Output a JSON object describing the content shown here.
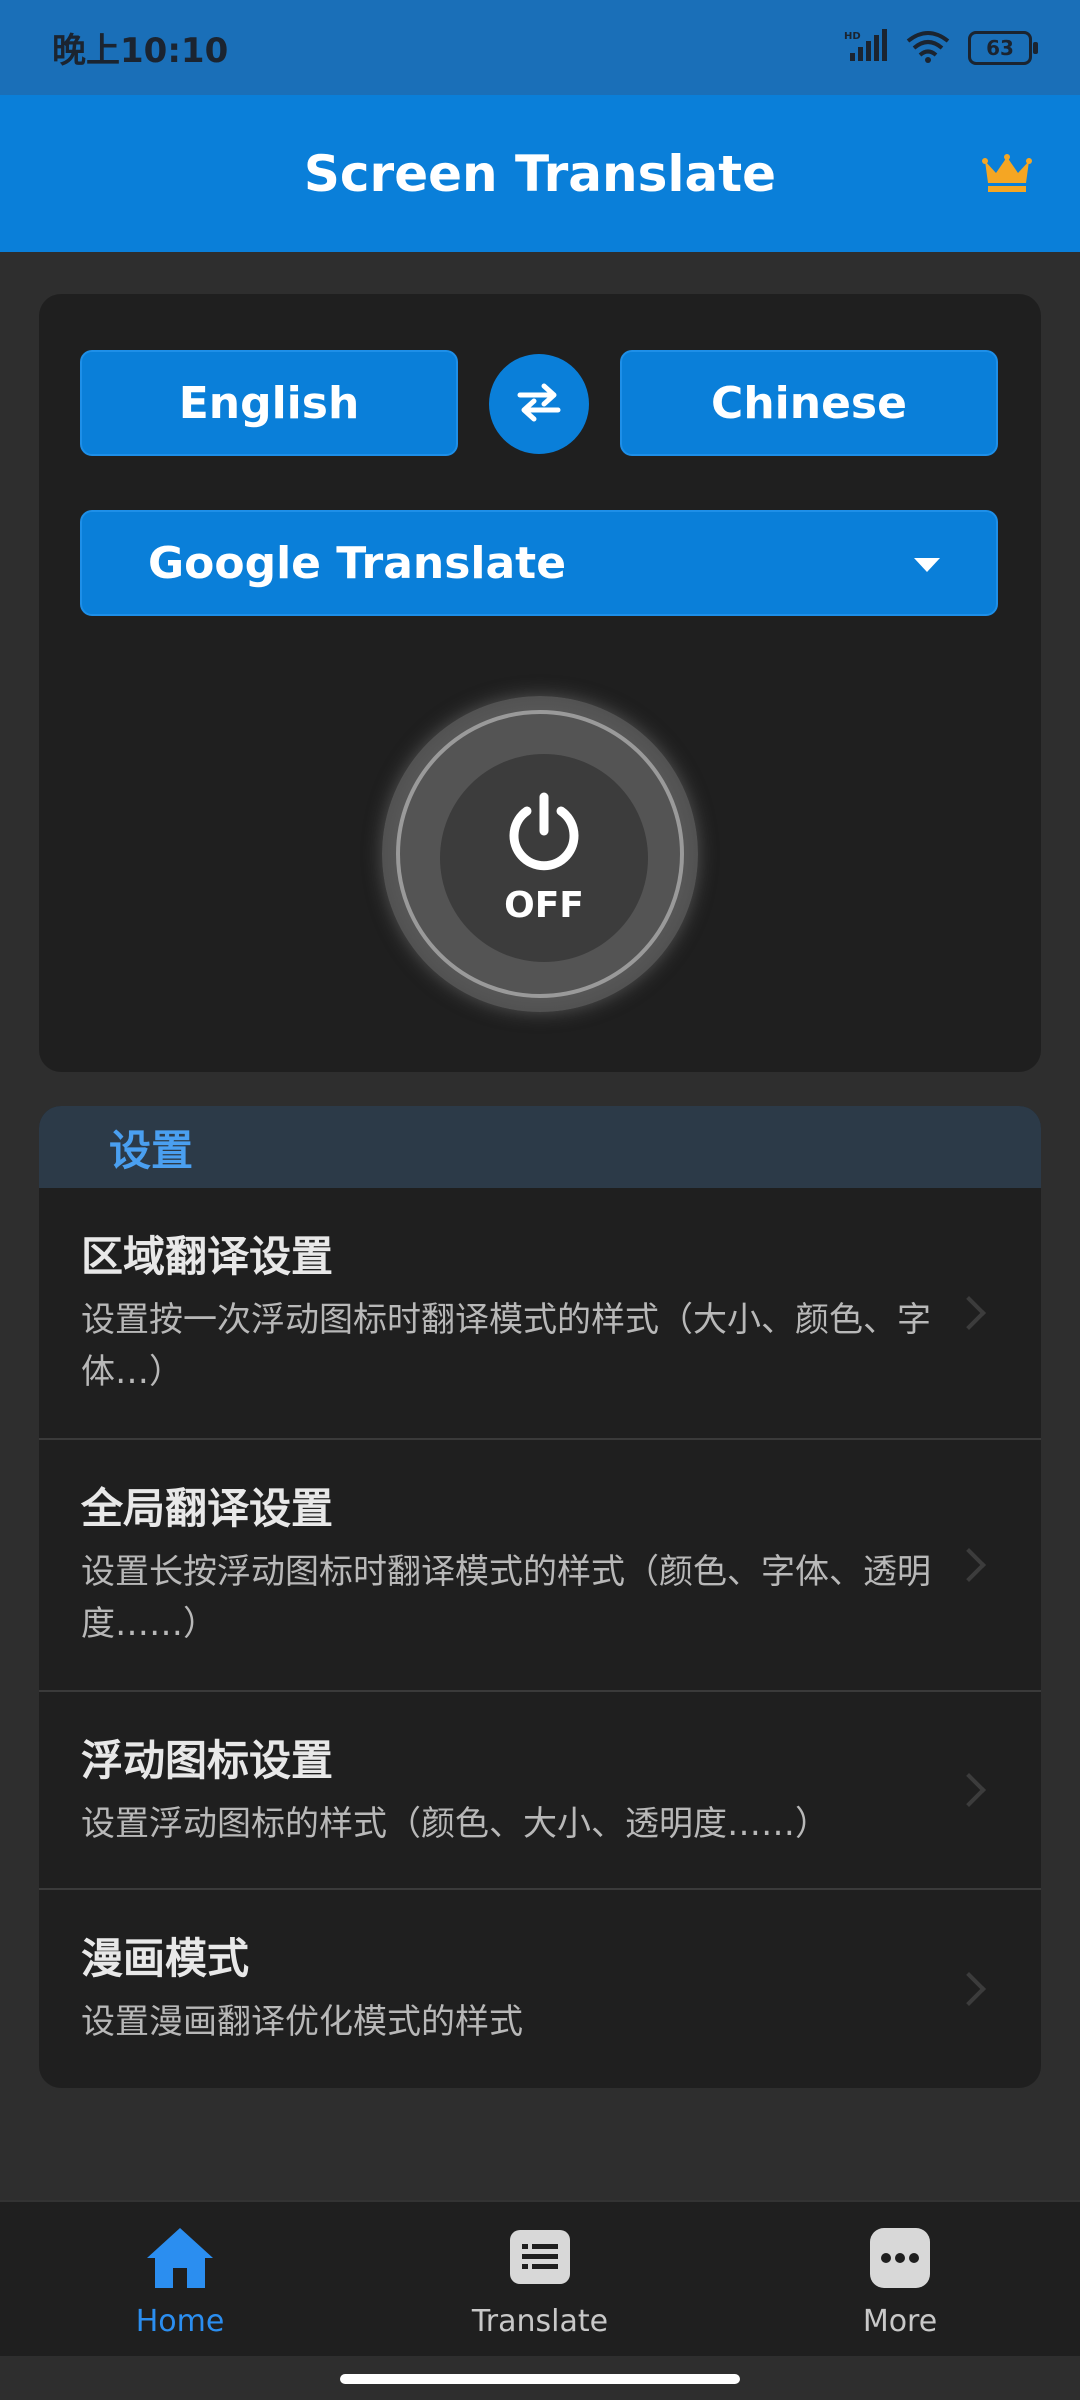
{
  "status_bar": {
    "time": "晚上10:10",
    "network": "HD",
    "battery": "63"
  },
  "app_bar": {
    "title": "Screen Translate",
    "premium_icon": "crown-icon"
  },
  "translator": {
    "source_language": "English",
    "target_language": "Chinese",
    "engine": "Google Translate",
    "power_state": "OFF"
  },
  "settings": {
    "header": "设置",
    "items": [
      {
        "title": "区域翻译设置",
        "desc": "设置按一次浮动图标时翻译模式的样式（大小、颜色、字体…）"
      },
      {
        "title": "全局翻译设置",
        "desc": "设置长按浮动图标时翻译模式的样式（颜色、字体、透明度……）"
      },
      {
        "title": "浮动图标设置",
        "desc": "设置浮动图标的样式（颜色、大小、透明度……）"
      },
      {
        "title": "漫画模式",
        "desc": "设置漫画翻译优化模式的样式"
      }
    ]
  },
  "bottom_nav": {
    "items": [
      {
        "label": "Home",
        "icon": "home-icon",
        "active": true
      },
      {
        "label": "Translate",
        "icon": "translate-icon",
        "active": false
      },
      {
        "label": "More",
        "icon": "more-icon",
        "active": false
      }
    ]
  },
  "colors": {
    "primary": "#0a7fd9",
    "status_bar": "#1a6fb8",
    "card": "#1f1f1f",
    "active_nav": "#2b8ef0"
  }
}
